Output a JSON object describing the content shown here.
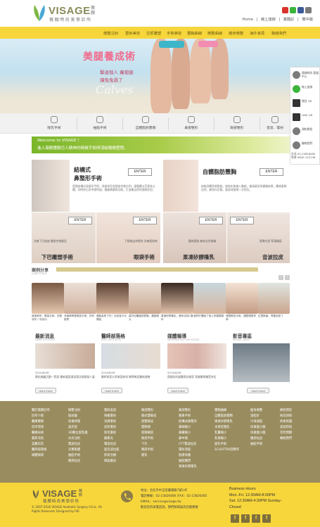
{
  "header": {
    "logo_text": "VISAGE",
    "logo_side": "薇顏",
    "logo_cn": "薇顏時尚美學診所",
    "top_links": [
      "Home",
      "|",
      "線上諮詢",
      "|",
      "實體診",
      "|",
      "簡中版"
    ],
    "social": [
      {
        "icon": "youtube-icon",
        "color": "#d9312c"
      },
      {
        "icon": "line-icon",
        "color": "#3bb53a"
      },
      {
        "icon": "facebook-icon",
        "color": "#3b5998"
      },
      {
        "icon": "mail-icon",
        "color": "#7a7a7a"
      }
    ]
  },
  "nav": [
    "微整注射",
    "雷射美容",
    "拉緊雕塑",
    "手術美容",
    "豐胸曲線",
    "微整曲線",
    "瘦身微整",
    "海外會員",
    "聯絡我們"
  ],
  "banner": {
    "title": "美腿養成術",
    "sub1": "擊退惱人 蘿蔔腿",
    "sub2": "讓兔兔過了",
    "script": "Calves"
  },
  "categories": [
    "隆乳手術",
    "抽脂手術",
    "自體脂肪豐胸",
    "鼻部整形",
    "眼部整形",
    "音波．電射"
  ],
  "welcome": {
    "title": "Welcome to VISAGE !",
    "text": "進入薇顏體驗巨人精神的精緻手術與頂級醫療歷程。"
  },
  "services": {
    "nose": {
      "title1": "結構式",
      "title2": "鼻整形手術",
      "enter": "ENTER",
      "desc": "透過結構式鼻整形手術，改變鼻型並塑造完美比例，讓整體五官更為立體；同時修正鼻中隔彎曲，兼顧美觀與功能，打造最自然的理想鼻型。"
    },
    "fat": {
      "title": "自體脂肪豐胸",
      "enter": "ENTER",
      "desc": "抽取身體多餘脂肪，經純化後植入胸部，兼具瘦身與豐胸效果，觸感柔軟自然，無排斥反應，讓身材曲線一次到位。"
    },
    "chin": {
      "title": "下巴雕塑手術",
      "enter": "ENTER",
      "cap": "改善下巴後縮 雕塑完美臉型"
    },
    "eye": {
      "title": "眼袋手術",
      "enter": "ENTER",
      "cap": "下眼瞼去除眼袋 改善疲倦感"
    },
    "breast": {
      "title": "果凍矽膠隆乳",
      "enter": "ENTER",
      "cap": "觸感柔軟 擁有自然美胸"
    },
    "lift": {
      "title": "音波拉皮",
      "enter": "ENTER",
      "cap": "緊緻拉提 緊實輪廓"
    }
  },
  "cases": {
    "title": "案例分享",
    "sub": "CASE STUDY",
    "prev": "‹",
    "next": "›",
    "items": [
      {
        "cap": "吳美美的：眼袋手術，完美消失一次成功"
      },
      {
        "cap": "深邃美眸雙眼皮手術，好評推薦"
      },
      {
        "cap": "擺脫金魚下巴！自信從今天開始"
      },
      {
        "cap": "嘉玲自體脂肪豐胸，腰瘦胸大"
      },
      {
        "cap": "果凍矽膠隆乳，擁有自然C罩杯"
      },
      {
        "cap": "我終於擺脫了惱人的蘿蔔腿"
      },
      {
        "cap": "縫雙眼皮手術，讓雙眼更有神"
      },
      {
        "cap": "拉提無痕，青春回來了"
      }
    ]
  },
  "columns": [
    {
      "title": "最新消息",
      "sub": "NEWS & EVENTS",
      "date": "2014/6/26",
      "text": "樂佑美麗活動一覽表 最新優惠資訊請洽詢客服人員",
      "readmore": "read more"
    },
    {
      "title": "醫師部落格",
      "sub": "DOCTOR'S BLOG",
      "date": "2014/6/26",
      "text": "醫師與您分享美容新知 醫學美容最新趨勢",
      "readmore": "read more"
    },
    {
      "title": "媒體報導",
      "sub": "INFORMATION FOR VISAGE",
      "date": "2014/6/26",
      "text": "薇顏診所媒體專訪報導 專業醫療備受肯定",
      "readmore": "read more"
    },
    {
      "title": "影音專區",
      "sub": "VISAGE VIDEO",
      "date": "",
      "text": "",
      "readmore": "read more"
    }
  ],
  "sidebar": [
    {
      "label": "薇顏時尚 客服中心",
      "icon": "headset-icon"
    },
    {
      "label": "線上諮詢",
      "icon": "line-icon"
    },
    {
      "label": "微信 QR",
      "icon": "wechat-icon"
    },
    {
      "label": "LINE QR",
      "icon": "qr-icon"
    },
    {
      "label": "預約療程",
      "icon": "calendar-icon"
    },
    {
      "label": "聯絡我們",
      "icon": "phone-icon"
    }
  ],
  "sidebar_phone": "台北 02-23826480 免費 0800-123138",
  "footer_columns": [
    [
      "關於薇顏診所",
      "診所介紹",
      "醫療團隊",
      "診所環境",
      "醫療技術",
      "最新消息",
      "美麗日誌",
      "醫師部落格",
      "媒體報導"
    ],
    [
      "微整注射",
      "玻尿酸",
      "肉毒桿菌",
      "晶亮瓷",
      "3D聚左旋乳酸",
      "水光注射",
      "電波拉皮",
      "洋蔥眼膜",
      "抽脂手術",
      "臉部拉皮"
    ],
    [
      "雷射美容",
      "飛梭雷射",
      "淨膚雷射",
      "皮秒雷射",
      "除毛雷射",
      "脈衝光",
      "電波拉皮",
      "超音波拉提",
      "肝斑治療",
      "微晶磨皮"
    ],
    [
      "眼部整形",
      "縫式雙眼皮",
      "割雙眼皮",
      "開眼頭",
      "提眼瞼肌",
      "眼袋手術",
      "下巴",
      "胸部手術",
      "隆乳"
    ],
    [
      "鼻部整形",
      "隆鼻手術",
      "結構式鼻整形",
      "鼻頭縮小",
      "鼻翼縮小",
      "鼻中隔",
      "CFT電波拉皮",
      "雷射溶脂",
      "肌膚保養",
      "抽脂雕塑",
      "果凍矽膠隆乳"
    ],
    [
      "豐胸曲線",
      "自體脂肪豐胸",
      "果凍矽膠隆乳",
      "水滴型隆乳",
      "乳暈縮小",
      "乳頭縮小",
      "副乳手術",
      "SCULPTRA舒顏萃"
    ],
    [
      "瘦身微整",
      "溶脂針",
      "冷凍減脂",
      "肉毒瘦小臉",
      "肉毒瘦小腿",
      "腹部拉皮",
      "抽脂手術"
    ],
    [
      "療程問答",
      "術前須知",
      "術後照護",
      "美容新知",
      "常見問題",
      "聯絡我們"
    ]
  ],
  "footer": {
    "logo": "VISAGE",
    "logo_side": "薇顏",
    "logo_cn": "薇顏時尚美學診所",
    "copy1": "© 2007-2016 VISAGE Aesthetic Surgery Clinic. All",
    "copy2": "Rights Reserved. Designed by IVE",
    "address": "地址：台北市中正區襄陽路7號14F",
    "phone": "電話專線：02-23826480 /FAX：02-23826485",
    "email": "EMAIL：service@visage.tw",
    "note": "歡迎您的來電諮詢，我們將竭誠為您服務喔",
    "hours_title": "Business Hours",
    "hours1": "Mon.-Fri. 12:30AM-8:00PM",
    "hours2": "Sat. 12:30AM-4:30PM Sunday-",
    "hours3": "Closed",
    "social": [
      "f",
      "f",
      "f",
      "f"
    ]
  }
}
